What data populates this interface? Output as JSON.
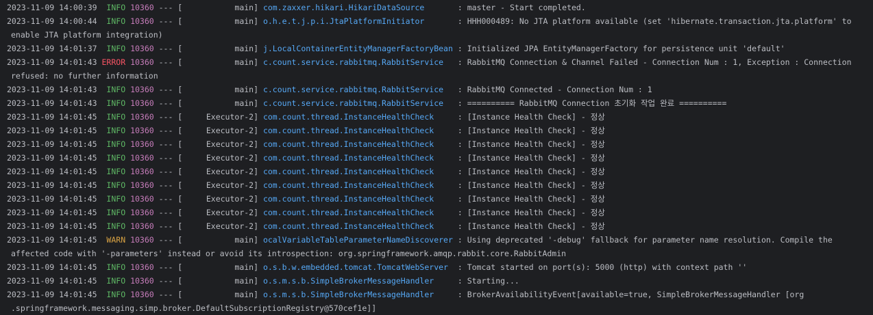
{
  "colors": {
    "background": "#1e1f22",
    "text": "#bcbec4",
    "info": "#5fb865",
    "warn": "#d9a343",
    "error": "#f75464",
    "pid": "#c77dbb",
    "logger": "#56a8f5"
  },
  "lines": [
    {
      "ts": "2023-11-09 14:00:39",
      "level": "INFO",
      "pid": "10360",
      "thread": "main",
      "logger": "com.zaxxer.hikari.HikariDataSource",
      "msg": "master - Start completed.",
      "cont": ""
    },
    {
      "ts": "2023-11-09 14:00:44",
      "level": "INFO",
      "pid": "10360",
      "thread": "main",
      "logger": "o.h.e.t.j.p.i.JtaPlatformInitiator",
      "msg": "HHH000489: No JTA platform available (set 'hibernate.transaction.jta.platform' to",
      "cont": "enable JTA platform integration)"
    },
    {
      "ts": "2023-11-09 14:01:37",
      "level": "INFO",
      "pid": "10360",
      "thread": "main",
      "logger": "j.LocalContainerEntityManagerFactoryBean",
      "msg": "Initialized JPA EntityManagerFactory for persistence unit 'default'",
      "cont": ""
    },
    {
      "ts": "2023-11-09 14:01:43",
      "level": "ERROR",
      "pid": "10360",
      "thread": "main",
      "logger": "c.count.service.rabbitmq.RabbitService",
      "msg": "RabbitMQ Connection & Channel Failed - Connection Num : 1, Exception : Connection",
      "cont": "refused: no further information"
    },
    {
      "ts": "2023-11-09 14:01:43",
      "level": "INFO",
      "pid": "10360",
      "thread": "main",
      "logger": "c.count.service.rabbitmq.RabbitService",
      "msg": "RabbitMQ Connected - Connection Num : 1",
      "cont": ""
    },
    {
      "ts": "2023-11-09 14:01:43",
      "level": "INFO",
      "pid": "10360",
      "thread": "main",
      "logger": "c.count.service.rabbitmq.RabbitService",
      "msg": "========== RabbitMQ Connection 초기화 작업 완료 ==========",
      "cont": ""
    },
    {
      "ts": "2023-11-09 14:01:45",
      "level": "INFO",
      "pid": "10360",
      "thread": "Executor-2",
      "logger": "com.count.thread.InstanceHealthCheck",
      "msg": "[Instance Health Check] - 정상",
      "cont": ""
    },
    {
      "ts": "2023-11-09 14:01:45",
      "level": "INFO",
      "pid": "10360",
      "thread": "Executor-2",
      "logger": "com.count.thread.InstanceHealthCheck",
      "msg": "[Instance Health Check] - 정상",
      "cont": ""
    },
    {
      "ts": "2023-11-09 14:01:45",
      "level": "INFO",
      "pid": "10360",
      "thread": "Executor-2",
      "logger": "com.count.thread.InstanceHealthCheck",
      "msg": "[Instance Health Check] - 정상",
      "cont": ""
    },
    {
      "ts": "2023-11-09 14:01:45",
      "level": "INFO",
      "pid": "10360",
      "thread": "Executor-2",
      "logger": "com.count.thread.InstanceHealthCheck",
      "msg": "[Instance Health Check] - 정상",
      "cont": ""
    },
    {
      "ts": "2023-11-09 14:01:45",
      "level": "INFO",
      "pid": "10360",
      "thread": "Executor-2",
      "logger": "com.count.thread.InstanceHealthCheck",
      "msg": "[Instance Health Check] - 정상",
      "cont": ""
    },
    {
      "ts": "2023-11-09 14:01:45",
      "level": "INFO",
      "pid": "10360",
      "thread": "Executor-2",
      "logger": "com.count.thread.InstanceHealthCheck",
      "msg": "[Instance Health Check] - 정상",
      "cont": ""
    },
    {
      "ts": "2023-11-09 14:01:45",
      "level": "INFO",
      "pid": "10360",
      "thread": "Executor-2",
      "logger": "com.count.thread.InstanceHealthCheck",
      "msg": "[Instance Health Check] - 정상",
      "cont": ""
    },
    {
      "ts": "2023-11-09 14:01:45",
      "level": "INFO",
      "pid": "10360",
      "thread": "Executor-2",
      "logger": "com.count.thread.InstanceHealthCheck",
      "msg": "[Instance Health Check] - 정상",
      "cont": ""
    },
    {
      "ts": "2023-11-09 14:01:45",
      "level": "INFO",
      "pid": "10360",
      "thread": "Executor-2",
      "logger": "com.count.thread.InstanceHealthCheck",
      "msg": "[Instance Health Check] - 정상",
      "cont": ""
    },
    {
      "ts": "2023-11-09 14:01:45",
      "level": "WARN",
      "pid": "10360",
      "thread": "main",
      "logger": "ocalVariableTableParameterNameDiscoverer",
      "msg": "Using deprecated '-debug' fallback for parameter name resolution. Compile the",
      "cont": "affected code with '-parameters' instead or avoid its introspection: org.springframework.amqp.rabbit.core.RabbitAdmin"
    },
    {
      "ts": "2023-11-09 14:01:45",
      "level": "INFO",
      "pid": "10360",
      "thread": "main",
      "logger": "o.s.b.w.embedded.tomcat.TomcatWebServer",
      "msg": "Tomcat started on port(s): 5000 (http) with context path ''",
      "cont": ""
    },
    {
      "ts": "2023-11-09 14:01:45",
      "level": "INFO",
      "pid": "10360",
      "thread": "main",
      "logger": "o.s.m.s.b.SimpleBrokerMessageHandler",
      "msg": "Starting...",
      "cont": ""
    },
    {
      "ts": "2023-11-09 14:01:45",
      "level": "INFO",
      "pid": "10360",
      "thread": "main",
      "logger": "o.s.m.s.b.SimpleBrokerMessageHandler",
      "msg": "BrokerAvailabilityEvent[available=true, SimpleBrokerMessageHandler [org",
      "cont": ".springframework.messaging.simp.broker.DefaultSubscriptionRegistry@570cef1e]]"
    }
  ]
}
